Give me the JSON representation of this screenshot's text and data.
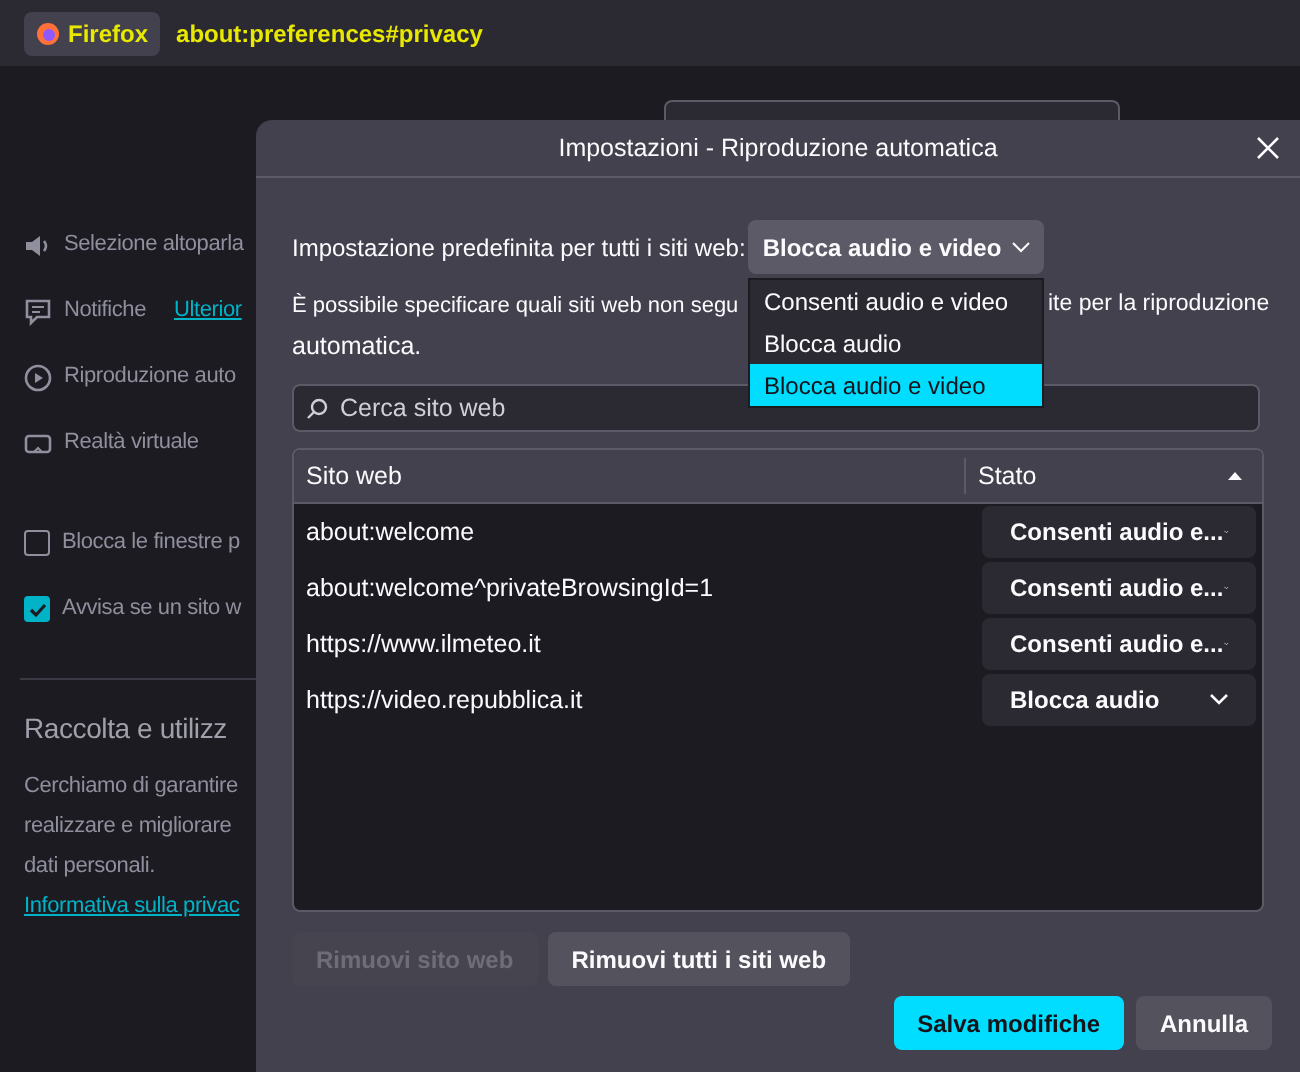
{
  "address_bar": {
    "identity": "Firefox",
    "url": "about:preferences#privacy"
  },
  "background": {
    "items": [
      {
        "label": "Selezione altoparla"
      },
      {
        "label": "Notifiche",
        "link": "Ulterior"
      },
      {
        "label": "Riproduzione auto"
      },
      {
        "label": "Realtà virtuale"
      }
    ],
    "checkboxes": [
      {
        "label": "Blocca le finestre p",
        "checked": false
      },
      {
        "label": "Avvisa se un sito w",
        "checked": true
      }
    ],
    "section": {
      "heading": "Raccolta e utilizz",
      "lines": [
        "Cerchiamo di garantire",
        "realizzare e migliorare",
        "dati personali."
      ],
      "link": "Informativa sulla privac"
    }
  },
  "dialog": {
    "title": "Impostazioni - Riproduzione automatica",
    "default_label": "Impostazione predefinita per tutti i siti web:",
    "default_dropdown": {
      "value": "Blocca audio e video",
      "expanded": true,
      "options": [
        {
          "label": "Consenti audio e video",
          "selected": false
        },
        {
          "label": "Blocca audio",
          "selected": false
        },
        {
          "label": "Blocca audio e video",
          "selected": true
        }
      ]
    },
    "description": {
      "before": "È possibile specificare quali siti web non segu",
      "after": "ite per la riproduzione",
      "tail": "automatica."
    },
    "search": {
      "placeholder": "Cerca sito web"
    },
    "table": {
      "columns": [
        {
          "label": "Sito web",
          "sorted": false
        },
        {
          "label": "Stato",
          "sorted": true
        }
      ],
      "rows": [
        {
          "site": "about:welcome",
          "status": "Consenti audio e..."
        },
        {
          "site": "about:welcome^privateBrowsingId=1",
          "status": "Consenti audio e..."
        },
        {
          "site": "https://www.ilmeteo.it",
          "status": "Consenti audio e..."
        },
        {
          "site": "https://video.repubblica.it",
          "status": "Blocca audio"
        }
      ]
    },
    "buttons": [
      {
        "label": "Rimuovi sito web",
        "disabled": true
      },
      {
        "label": "Rimuovi tutti i siti web",
        "disabled": false
      }
    ],
    "footer_buttons": [
      {
        "label": "Salva modifiche",
        "primary": true
      },
      {
        "label": "Annulla",
        "primary": false
      }
    ]
  }
}
